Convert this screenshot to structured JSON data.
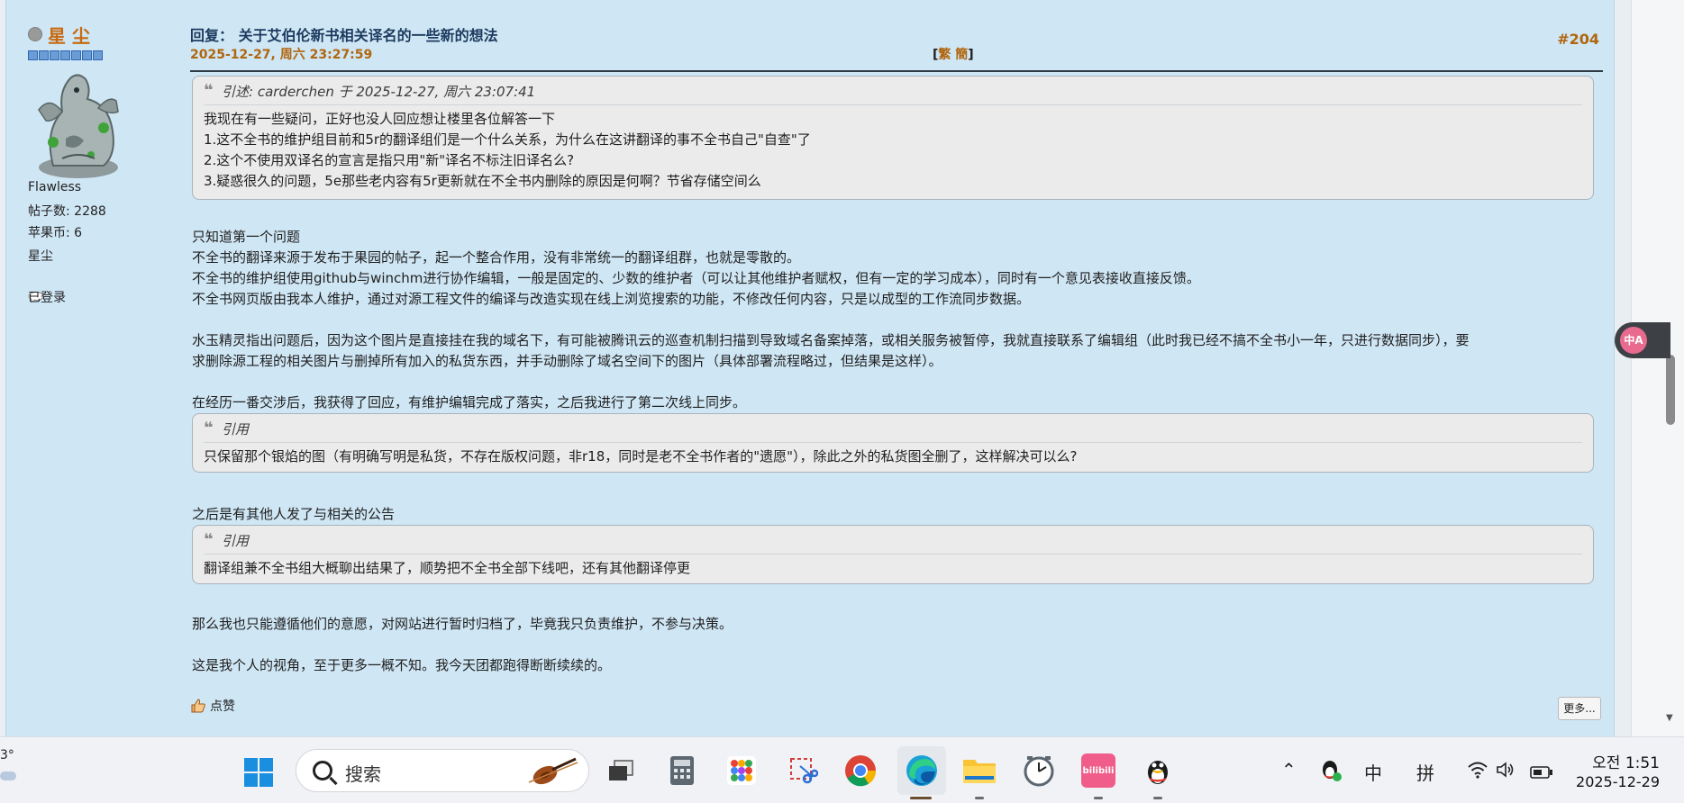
{
  "profile": {
    "username": "星 尘",
    "group": "Flawless",
    "posts_label": "帖子数: 2288",
    "coins_label": "苹果币: 6",
    "title": "星尘",
    "status": "已登录"
  },
  "post": {
    "title": "回复： 关于艾伯伦新书相关译名的一些新的想法",
    "date": "2025-12-27, 周六 23:27:59",
    "number": "#204",
    "trad_label": "繁",
    "simp_label": "簡",
    "quote1": {
      "header": "引述: carderchen 于 2025-12-27, 周六 23:07:41",
      "lines": [
        "我现在有一些疑问，正好也没人回应想让楼里各位解答一下",
        "1.这不全书的维护组目前和5r的翻译组们是一个什么关系，为什么在这讲翻译的事不全书自己\"自查\"了",
        "2.这个不使用双译名的宣言是指只用\"新\"译名不标注旧译名么?",
        "3.疑惑很久的问题，5e那些老内容有5r更新就在不全书内删除的原因是何啊？节省存储空间么"
      ]
    },
    "body1": [
      "只知道第一个问题",
      "不全书的翻译来源于发布于果园的帖子，起一个整合作用，没有非常统一的翻译组群，也就是零散的。",
      "不全书的维护组使用github与winchm进行协作编辑，一般是固定的、少数的维护者（可以让其他维护者赋权，但有一定的学习成本），同时有一个意见表接收直接反馈。",
      "不全书网页版由我本人维护，通过对源工程文件的编译与改造实现在线上浏览搜索的功能，不修改任何内容，只是以成型的工作流同步数据。"
    ],
    "body2": [
      "水玉精灵指出问题后，因为这个图片是直接挂在我的域名下，有可能被腾讯云的巡查机制扫描到导致域名备案掉落，或相关服务被暂停，我就直接联系了编辑组（此时我已经不搞不全书小一年，只进行数据同步），要",
      "求删除源工程的相关图片与删掉所有加入的私货东西，并手动删除了域名空间下的图片（具体部署流程略过，但结果是这样）。"
    ],
    "body3": "在经历一番交涉后，我获得了回应，有维护编辑完成了落实，之后我进行了第二次线上同步。",
    "quote2": {
      "header": "引用",
      "line": "只保留那个银焰的图（有明确写明是私货，不存在版权问题，非r18，同时是老不全书作者的\"遗愿\"），除此之外的私货图全删了，这样解决可以么?"
    },
    "body4": "之后是有其他人发了与相关的公告",
    "quote3": {
      "header": "引用",
      "line": "翻译组兼不全书组大概聊出结果了，顺势把不全书全部下线吧，还有其他翻译停更"
    },
    "body5": "那么我也只能遵循他们的意愿，对网站进行暂时归档了，毕竟我只负责维护，不参与决策。",
    "body6": "这是我个人的视角，至于更多一概不知。我今天团都跑得断断续续的。",
    "like_label": "点赞",
    "more_label": "更多..."
  },
  "translate_widget": {
    "label": "中A"
  },
  "taskbar": {
    "weather_temp": "3°",
    "search_placeholder": "搜索",
    "ime_lang": "中",
    "ime_mode": "拼",
    "clock_time": "오전 1:51",
    "clock_date": "2025-12-29",
    "bilibili_label": "bilibili"
  },
  "colors": {
    "post_bg": "#cfe6f4",
    "username": "#c66a12",
    "date": "#b0660f",
    "title": "#1d3b60",
    "quote_bg": "#ebebeb"
  }
}
